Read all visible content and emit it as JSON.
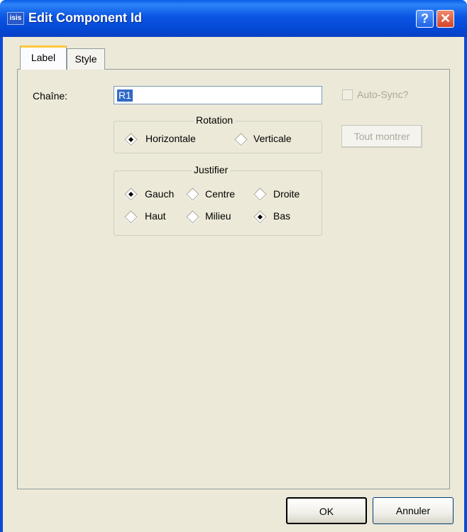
{
  "window": {
    "title": "Edit Component Id",
    "app_icon_text": "isis",
    "help_label": "?",
    "close_label": "✕"
  },
  "tabs": [
    {
      "label": "Label"
    },
    {
      "label": "Style"
    }
  ],
  "form": {
    "string_label": "Chaîne:",
    "string_value": "R1",
    "auto_sync_label": "Auto-Sync?",
    "show_all_label": "Tout montrer"
  },
  "rotation": {
    "legend": "Rotation",
    "options": [
      {
        "label": "Horizontale",
        "selected": true
      },
      {
        "label": "Verticale",
        "selected": false
      }
    ]
  },
  "justify": {
    "legend": "Justifier",
    "options": [
      {
        "label": "Gauch",
        "selected": true
      },
      {
        "label": "Centre",
        "selected": false
      },
      {
        "label": "Droite",
        "selected": false
      },
      {
        "label": "Haut",
        "selected": false
      },
      {
        "label": "Milieu",
        "selected": false
      },
      {
        "label": "Bas",
        "selected": true
      }
    ]
  },
  "buttons": {
    "ok": "OK",
    "cancel": "Annuler"
  }
}
